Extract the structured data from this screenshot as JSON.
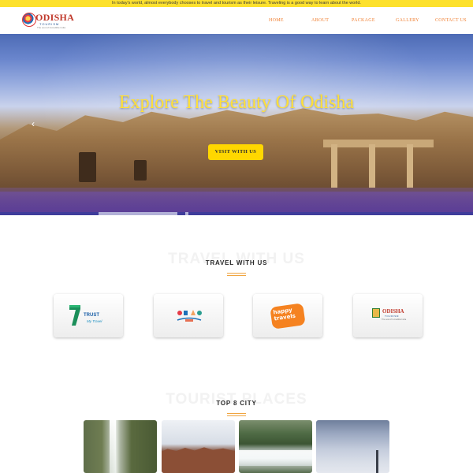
{
  "topbar": {
    "text": "In today's world, almost everybody chooses to travel and tourism as their leisure. Traveling is a good way to learn about the world."
  },
  "brand": {
    "name": "ODISHA",
    "sub": "TOURISM",
    "tagline": "The soul of Incredible India"
  },
  "nav": {
    "items": [
      {
        "label": "HOME"
      },
      {
        "label": "ABOUT"
      },
      {
        "label": "PACKAGE"
      },
      {
        "label": "GALLERY"
      },
      {
        "label": "CONTACT US"
      }
    ]
  },
  "hero": {
    "title": "Explore The Beauty Of Odisha",
    "button_label": "VISIT WITH US",
    "prev_arrow": "‹"
  },
  "travel_section": {
    "bg_text": "TRAVEL WITH US",
    "title": "TRAVEL WITH US",
    "partners": [
      {
        "icon": "trust-my-travel-logo",
        "name": "TRUST",
        "sub": "My Travel"
      },
      {
        "icon": "travel-icons-logo"
      },
      {
        "icon": "happy-travels-logo",
        "name": "happy travels"
      },
      {
        "icon": "odisha-tourism-logo",
        "name": "ODISHA",
        "sub": "TOURISM",
        "tag": "The soul of Incredible India"
      }
    ]
  },
  "places_section": {
    "bg_text": "TOURIST PLACES",
    "title": "TOP 8 CITY",
    "cities": [
      {
        "image": "waterfall-cliff-photo"
      },
      {
        "image": "rock-ruins-photo"
      },
      {
        "image": "waterfall-forest-photo"
      },
      {
        "image": "cloudy-sky-tower-photo"
      }
    ]
  },
  "colors": {
    "topbar": "#fde12d",
    "nav_text": "#f07f31",
    "hero_title": "#ffe03a",
    "hero_button": "#ffd700",
    "divider": "#f0a541"
  }
}
